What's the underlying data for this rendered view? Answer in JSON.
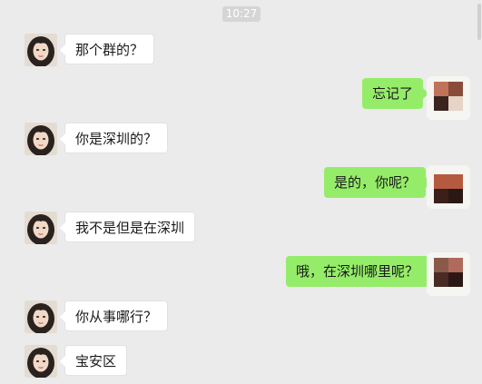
{
  "chat": {
    "timestamp": "10:27",
    "messages": [
      {
        "side": "left",
        "text": "那个群的？"
      },
      {
        "side": "right",
        "text": "忘记了"
      },
      {
        "side": "left",
        "text": "你是深圳的？"
      },
      {
        "side": "right",
        "text": "是的，你呢？"
      },
      {
        "side": "left",
        "text": "我不是但是在深圳"
      },
      {
        "side": "right",
        "text": "哦，在深圳哪里呢？"
      },
      {
        "side": "left",
        "text": "你从事哪行？"
      },
      {
        "side": "left",
        "text": "宝安区"
      }
    ]
  },
  "colors": {
    "background": "#ebebeb",
    "incoming_bubble": "#ffffff",
    "outgoing_bubble": "#95ec69",
    "timestamp_bg": "#d5d5d5"
  },
  "icons": {
    "contact_avatar": "woman-portrait-avatar",
    "own_avatar": "pixelated-avatar"
  }
}
